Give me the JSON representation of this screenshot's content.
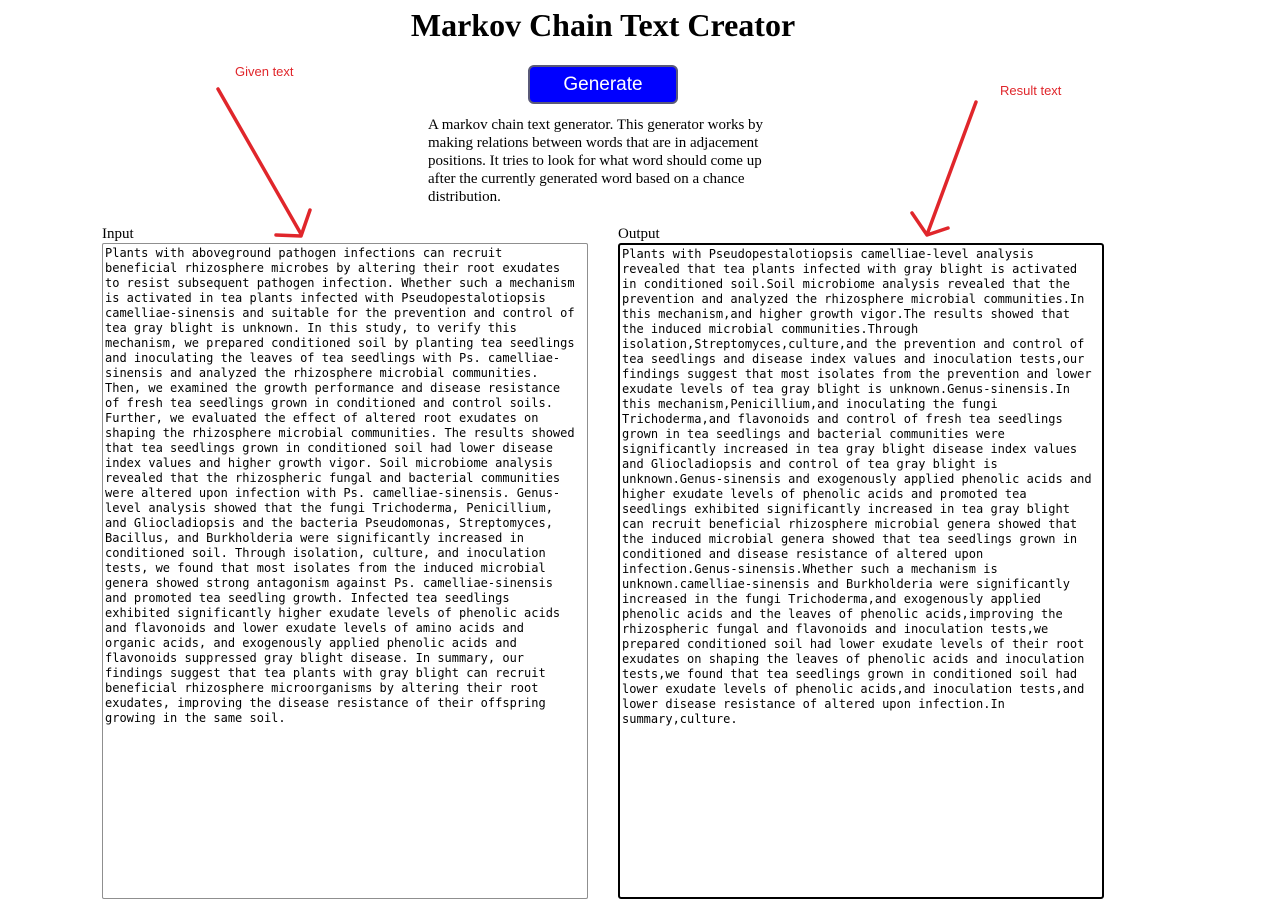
{
  "page": {
    "title": "Markov Chain Text Creator",
    "generate_label": "Generate",
    "description": "A markov chain text generator. This generator works by making relations between words that are in adjacement positions. It tries to look for what word should come up after the currently generated word based on a chance distribution."
  },
  "annotations": {
    "given_text": "Given text",
    "result_text": "Result text",
    "color": "#e0262b"
  },
  "input": {
    "label": "Input",
    "value": "Plants with aboveground pathogen infections can recruit\nbeneficial rhizosphere microbes by altering their root exudates\nto resist subsequent pathogen infection. Whether such a mechanism\nis activated in tea plants infected with Pseudopestalotiopsis\ncamelliae-sinensis and suitable for the prevention and control of\ntea gray blight is unknown. In this study, to verify this\nmechanism, we prepared conditioned soil by planting tea seedlings\nand inoculating the leaves of tea seedlings with Ps. camelliae-\nsinensis and analyzed the rhizosphere microbial communities.\nThen, we examined the growth performance and disease resistance\nof fresh tea seedlings grown in conditioned and control soils.\nFurther, we evaluated the effect of altered root exudates on\nshaping the rhizosphere microbial communities. The results showed\nthat tea seedlings grown in conditioned soil had lower disease\nindex values and higher growth vigor. Soil microbiome analysis\nrevealed that the rhizospheric fungal and bacterial communities\nwere altered upon infection with Ps. camelliae-sinensis. Genus-\nlevel analysis showed that the fungi Trichoderma, Penicillium,\nand Gliocladiopsis and the bacteria Pseudomonas, Streptomyces,\nBacillus, and Burkholderia were significantly increased in\nconditioned soil. Through isolation, culture, and inoculation\ntests, we found that most isolates from the induced microbial\ngenera showed strong antagonism against Ps. camelliae-sinensis\nand promoted tea seedling growth. Infected tea seedlings\nexhibited significantly higher exudate levels of phenolic acids\nand flavonoids and lower exudate levels of amino acids and\norganic acids, and exogenously applied phenolic acids and\nflavonoids suppressed gray blight disease. In summary, our\nfindings suggest that tea plants with gray blight can recruit\nbeneficial rhizosphere microorganisms by altering their root\nexudates, improving the disease resistance of their offspring\ngrowing in the same soil."
  },
  "output": {
    "label": "Output",
    "value": "Plants with Pseudopestalotiopsis camelliae-level analysis\nrevealed that tea plants infected with gray blight is activated\nin conditioned soil.Soil microbiome analysis revealed that the\nprevention and analyzed the rhizosphere microbial communities.In\nthis mechanism,and higher growth vigor.The results showed that\nthe induced microbial communities.Through\nisolation,Streptomyces,culture,and the prevention and control of\ntea seedlings and disease index values and inoculation tests,our\nfindings suggest that most isolates from the prevention and lower\nexudate levels of tea gray blight is unknown.Genus-sinensis.In\nthis mechanism,Penicillium,and inoculating the fungi\nTrichoderma,and flavonoids and control of fresh tea seedlings\ngrown in tea seedlings and bacterial communities were\nsignificantly increased in tea gray blight disease index values\nand Gliocladiopsis and control of tea gray blight is\nunknown.Genus-sinensis and exogenously applied phenolic acids and\nhigher exudate levels of phenolic acids and promoted tea\nseedlings exhibited significantly increased in tea gray blight\ncan recruit beneficial rhizosphere microbial genera showed that\nthe induced microbial genera showed that tea seedlings grown in\nconditioned and disease resistance of altered upon\ninfection.Genus-sinensis.Whether such a mechanism is\nunknown.camelliae-sinensis and Burkholderia were significantly\nincreased in the fungi Trichoderma,and exogenously applied\nphenolic acids and the leaves of phenolic acids,improving the\nrhizospheric fungal and flavonoids and inoculation tests,we\nprepared conditioned soil had lower exudate levels of their root\nexudates on shaping the leaves of phenolic acids and inoculation\ntests,we found that tea seedlings grown in conditioned soil had\nlower exudate levels of phenolic acids,and inoculation tests,and\nlower disease resistance of altered upon infection.In\nsummary,culture."
  },
  "colors": {
    "button_bg": "#0000ff",
    "button_text": "#ffffff"
  }
}
